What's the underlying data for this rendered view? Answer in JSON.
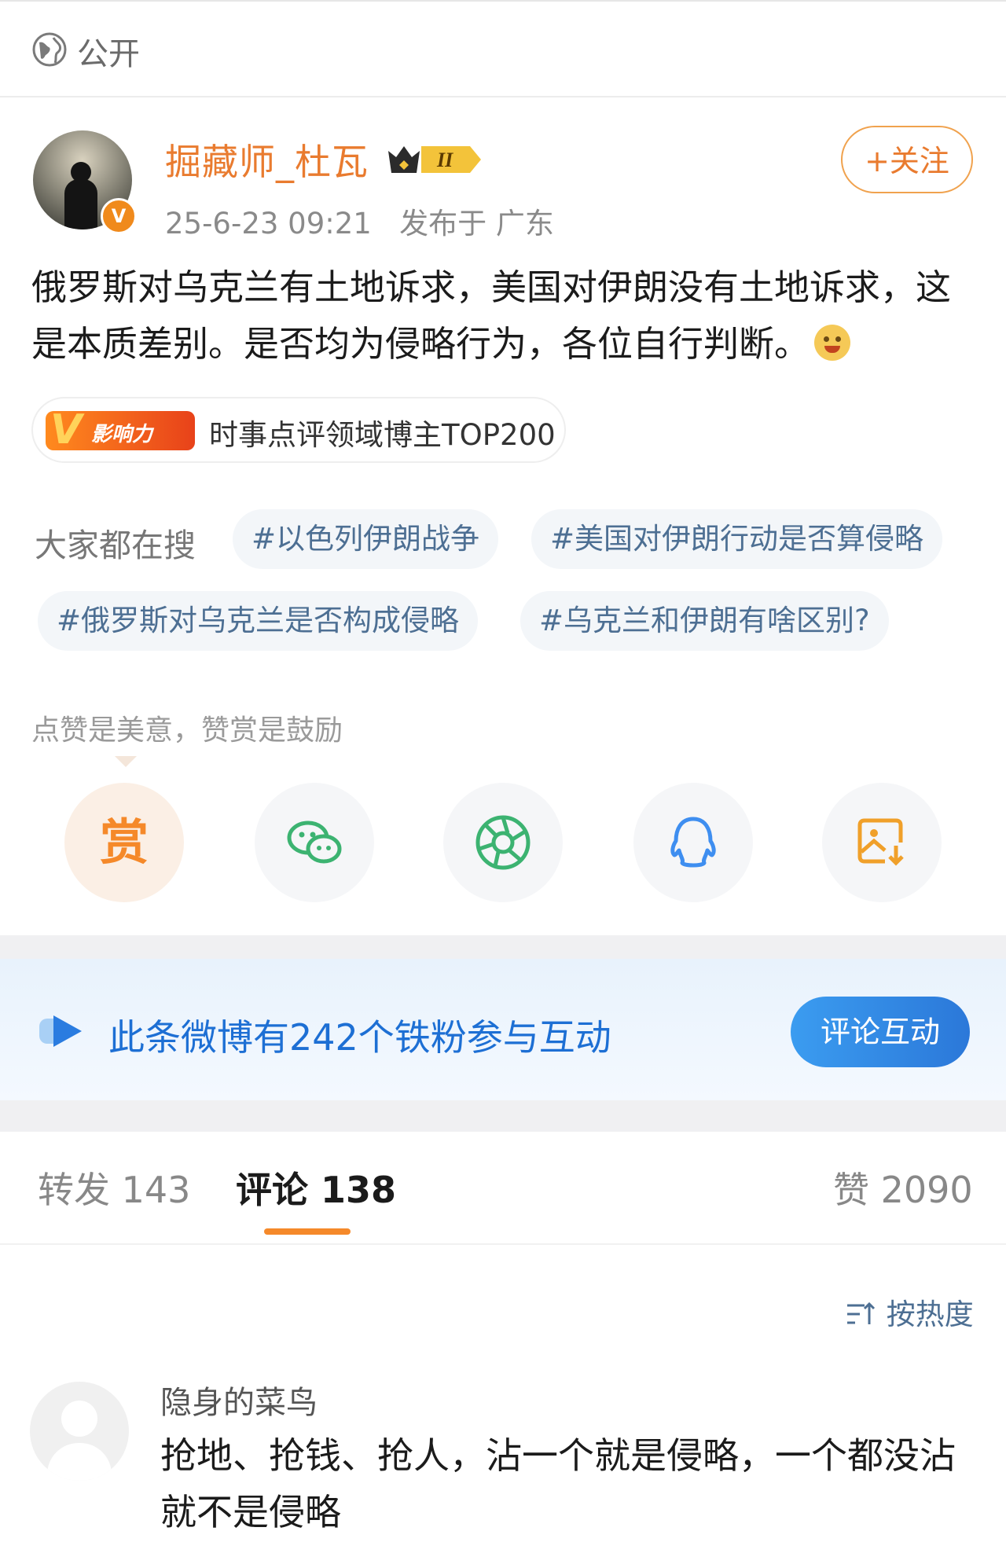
{
  "privacy": {
    "label": "公开",
    "icon": "globe-icon"
  },
  "author": {
    "name": "掘藏师_杜瓦",
    "level_badge": "II",
    "verified_badge": "V",
    "time": "25-6-23 09:21",
    "location": "发布于 广东",
    "follow_label": "+关注"
  },
  "post": {
    "text": "俄罗斯对乌克兰有土地诉求，美国对伊朗没有土地诉求，这是本质差别。是否均为侵略行为，各位自行判断。",
    "emoji": "smile-emoji-icon"
  },
  "influence": {
    "badge_v": "V",
    "badge_text": "影响力",
    "label": "时事点评领域博主TOP200"
  },
  "search": {
    "label": "大家都在搜",
    "chips": [
      "#以色列伊朗战争",
      "#美国对伊朗行动是否算侵略",
      "#俄罗斯对乌克兰是否构成侵略",
      "#乌克兰和伊朗有啥区别?"
    ]
  },
  "reward": {
    "note": "点赞是美意，赞赏是鼓励",
    "reward_label": "赏"
  },
  "share": [
    "reward-icon",
    "wechat-icon",
    "moments-icon",
    "qq-icon",
    "save-image-icon"
  ],
  "fans": {
    "text": "此条微博有242个铁粉参与互动",
    "button": "评论互动"
  },
  "tabs": {
    "repost": "转发 143",
    "comment": "评论 138",
    "like": "赞 2090"
  },
  "sort": {
    "label": "按热度"
  },
  "comment": {
    "name": "隐身的菜鸟",
    "text": "抢地、抢钱、抢人，沾一个就是侵略，一个都没沾就不是侵略"
  },
  "colors": {
    "orange": "#e97b2f",
    "blue": "#1d6fd4",
    "chip_text": "#4d6f93"
  }
}
